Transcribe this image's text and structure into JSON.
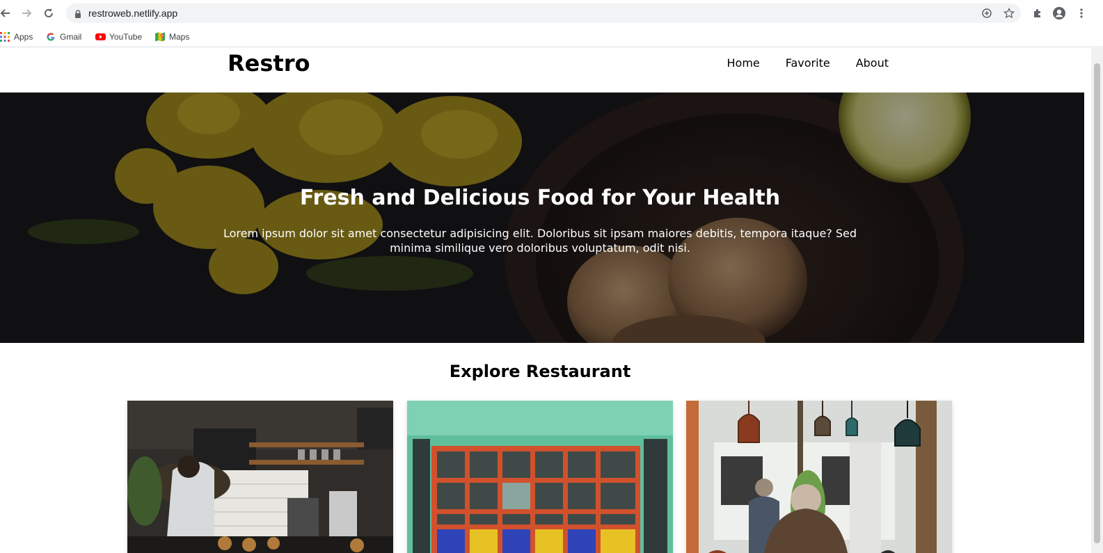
{
  "browser": {
    "url": "restroweb.netlify.app",
    "bookmarks": [
      {
        "label": "Apps",
        "icon": "apps-grid-icon"
      },
      {
        "label": "Gmail",
        "icon": "google-icon"
      },
      {
        "label": "YouTube",
        "icon": "youtube-icon"
      },
      {
        "label": "Maps",
        "icon": "maps-icon"
      }
    ]
  },
  "site": {
    "brand": "Restro",
    "nav": [
      "Home",
      "Favorite",
      "About"
    ]
  },
  "hero": {
    "title": "Fresh and Delicious Food for Your Health",
    "text": "Lorem ipsum dolor sit amet consectetur adipisicing elit. Doloribus sit ipsam maiores debitis, tempora itaque? Sed minima similique vero doloribus voluptatum, odit nisi."
  },
  "explore": {
    "title": "Explore Restaurant",
    "cards": [
      {
        "image": "cafe-barista-photo"
      },
      {
        "image": "storefront-window-photo"
      },
      {
        "image": "restaurant-interior-photo"
      }
    ]
  },
  "colors": {
    "hero_overlay": "#1d1d1f",
    "omnibox": "#f1f3f4"
  }
}
